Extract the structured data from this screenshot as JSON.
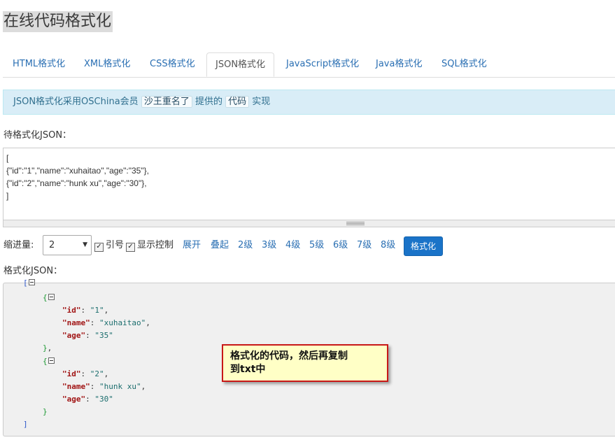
{
  "page_title": "在线代码格式化",
  "tabs": [
    {
      "label": "HTML格式化",
      "active": false
    },
    {
      "label": "XML格式化",
      "active": false
    },
    {
      "label": "CSS格式化",
      "active": false
    },
    {
      "label": "JSON格式化",
      "active": true
    },
    {
      "label": "JavaScript格式化",
      "active": false
    },
    {
      "label": "Java格式化",
      "active": false
    },
    {
      "label": "SQL格式化",
      "active": false
    }
  ],
  "info": {
    "prefix": "JSON格式化采用OSChina会员",
    "member": "沙王重名了",
    "middle": "提供的",
    "code": "代码",
    "suffix": "实现"
  },
  "input": {
    "label": "待格式化JSON：",
    "lines": [
      "[",
      "{\"id\":\"1\",\"name\":\"xuhaitao\",\"age\":\"35\"},",
      "{\"id\":\"2\",\"name\":\"hunk xu\",\"age\":\"30\"},",
      "]"
    ]
  },
  "controls": {
    "indent_label": "缩进量:",
    "indent_value": "2",
    "quote_label": "引号",
    "quote_checked": true,
    "show_control_label": "显示控制",
    "show_control_checked": true,
    "expand": "展开",
    "collapse": "叠起",
    "levels": [
      "2级",
      "3级",
      "4级",
      "5级",
      "6级",
      "7级",
      "8级"
    ],
    "format_button": "格式化"
  },
  "output": {
    "label": "格式化JSON：",
    "objects": [
      {
        "fields": [
          [
            "id",
            "1"
          ],
          [
            "name",
            "xuhaitao"
          ],
          [
            "age",
            "35"
          ]
        ]
      },
      {
        "fields": [
          [
            "id",
            "2"
          ],
          [
            "name",
            "hunk xu"
          ],
          [
            "age",
            "30"
          ]
        ]
      }
    ]
  },
  "callout": {
    "line1": "格式化的代码，然后再复制",
    "line2": "到txt中"
  },
  "colors": {
    "link": "#2a6fb3",
    "button": "#1a73c8",
    "info_bg": "#d9edf7",
    "json_key": "#a11515",
    "json_value": "#1c6e6e",
    "callout_border": "#c81818"
  }
}
